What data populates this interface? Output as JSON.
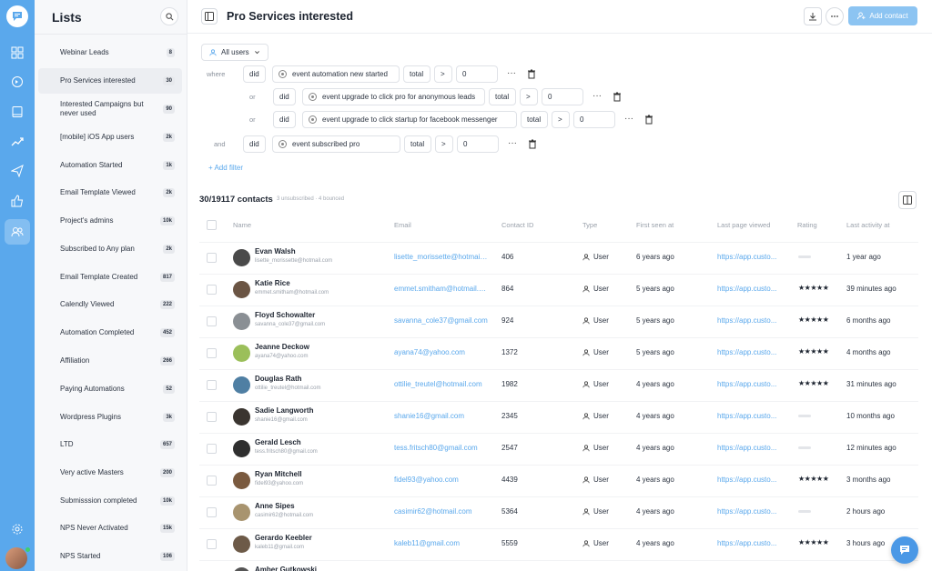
{
  "lists": {
    "title": "Lists",
    "items": [
      {
        "label": "Webinar Leads",
        "count": "8"
      },
      {
        "label": "Pro Services interested",
        "count": "30"
      },
      {
        "label": "Interested Campaigns but never used",
        "count": "90"
      },
      {
        "label": "[mobile] iOS App users",
        "count": "2k"
      },
      {
        "label": "Automation Started",
        "count": "1k"
      },
      {
        "label": "Email Template Viewed",
        "count": "2k"
      },
      {
        "label": "Project's admins",
        "count": "10k"
      },
      {
        "label": "Subscribed to Any plan",
        "count": "2k"
      },
      {
        "label": "Email Template Created",
        "count": "817"
      },
      {
        "label": "Calendly Viewed",
        "count": "222"
      },
      {
        "label": "Automation Completed",
        "count": "452"
      },
      {
        "label": "Affiliation",
        "count": "266"
      },
      {
        "label": "Paying Automations",
        "count": "52"
      },
      {
        "label": "Wordpress Plugins",
        "count": "3k"
      },
      {
        "label": "LTD",
        "count": "657"
      },
      {
        "label": "Very active Masters",
        "count": "200"
      },
      {
        "label": "Submisssion completed",
        "count": "10k"
      },
      {
        "label": "NPS Never Activated",
        "count": "15k"
      },
      {
        "label": "NPS Started",
        "count": "106"
      }
    ]
  },
  "header": {
    "title": "Pro Services interested",
    "add_contact": "Add contact"
  },
  "filters": {
    "audience": "All users",
    "add_filter": "+ Add filter",
    "rows": [
      {
        "connector": "where",
        "op": "did",
        "event": "event automation new started",
        "agg": "total",
        "cmp": ">",
        "value": "0"
      },
      {
        "connector": "or",
        "op": "did",
        "event": "event upgrade to click pro for anonymous leads",
        "agg": "total",
        "cmp": ">",
        "value": "0"
      },
      {
        "connector": "or",
        "op": "did",
        "event": "event upgrade to click startup for facebook messenger",
        "agg": "total",
        "cmp": ">",
        "value": "0"
      },
      {
        "connector": "and",
        "op": "did",
        "event": "event subscribed pro",
        "agg": "total",
        "cmp": ">",
        "value": "0"
      }
    ],
    "more": "···"
  },
  "contacts": {
    "heading": "30/19117 contacts",
    "sub": "3 unsubscribed · 4 bounced",
    "columns": [
      "Name",
      "Email",
      "Contact ID",
      "Type",
      "First seen at",
      "Last page viewed",
      "Rating",
      "Last activity at"
    ],
    "rows": [
      {
        "name": "Evan Walsh",
        "sub": "lisette_morissette@hotmail.com",
        "email": "lisette_morissette@hotmail.com",
        "id": "406",
        "type": "User",
        "first": "6 years ago",
        "page": "https://app.custo...",
        "rating": "",
        "last": "1 year ago",
        "avatar": "#4a4a4a"
      },
      {
        "name": "Katie Rice",
        "sub": "emmet.smitham@hotmail.com",
        "email": "emmet.smitham@hotmail.com",
        "id": "864",
        "type": "User",
        "first": "5 years ago",
        "page": "https://app.custo...",
        "rating": "★★★★★",
        "last": "39 minutes ago",
        "avatar": "#6b5544"
      },
      {
        "name": "Floyd Schowalter",
        "sub": "savanna_cole37@gmail.com",
        "email": "savanna_cole37@gmail.com",
        "id": "924",
        "type": "User",
        "first": "5 years ago",
        "page": "https://app.custo...",
        "rating": "★★★★★",
        "last": "6 months ago",
        "avatar": "#8a8f94"
      },
      {
        "name": "Jeanne Deckow",
        "sub": "ayana74@yahoo.com",
        "email": "ayana74@yahoo.com",
        "id": "1372",
        "type": "User",
        "first": "5 years ago",
        "page": "https://app.custo...",
        "rating": "★★★★★",
        "last": "4 months ago",
        "avatar": "#9bbf5a"
      },
      {
        "name": "Douglas Rath",
        "sub": "ottilie_treutel@hotmail.com",
        "email": "ottilie_treutel@hotmail.com",
        "id": "1982",
        "type": "User",
        "first": "4 years ago",
        "page": "https://app.custo...",
        "rating": "★★★★★",
        "last": "31 minutes ago",
        "avatar": "#4f7fa3"
      },
      {
        "name": "Sadie Langworth",
        "sub": "shanie16@gmail.com",
        "email": "shanie16@gmail.com",
        "id": "2345",
        "type": "User",
        "first": "4 years ago",
        "page": "https://app.custo...",
        "rating": "",
        "last": "10 months ago",
        "avatar": "#3a3530"
      },
      {
        "name": "Gerald Lesch",
        "sub": "tess.fritsch80@gmail.com",
        "email": "tess.fritsch80@gmail.com",
        "id": "2547",
        "type": "User",
        "first": "4 years ago",
        "page": "https://app.custo...",
        "rating": "",
        "last": "12 minutes ago",
        "avatar": "#2f2f2f"
      },
      {
        "name": "Ryan Mitchell",
        "sub": "fidel93@yahoo.com",
        "email": "fidel93@yahoo.com",
        "id": "4439",
        "type": "User",
        "first": "4 years ago",
        "page": "https://app.custo...",
        "rating": "★★★★★",
        "last": "3 months ago",
        "avatar": "#7a5a3f"
      },
      {
        "name": "Anne Sipes",
        "sub": "casimir62@hotmail.com",
        "email": "casimir62@hotmail.com",
        "id": "5364",
        "type": "User",
        "first": "4 years ago",
        "page": "https://app.custo...",
        "rating": "",
        "last": "2 hours ago",
        "avatar": "#a8946f"
      },
      {
        "name": "Gerardo Keebler",
        "sub": "kaleb11@gmail.com",
        "email": "kaleb11@gmail.com",
        "id": "5559",
        "type": "User",
        "first": "4 years ago",
        "page": "https://app.custo...",
        "rating": "★★★★★",
        "last": "3 hours ago",
        "avatar": "#6d5a48"
      },
      {
        "name": "Amber Gutkowski",
        "sub": "",
        "email": "",
        "id": "",
        "type": "",
        "first": "",
        "page": "",
        "rating": "",
        "last": "",
        "avatar": "#555"
      }
    ]
  },
  "colors": {
    "accent": "#5aa8ec",
    "rail": "#5aa8ec"
  },
  "icons": [
    "logo-icon",
    "dashboard-icon",
    "automation-icon",
    "book-icon",
    "trend-icon",
    "send-icon",
    "thumbs-up-icon",
    "users-icon",
    "settings-icon",
    "search-icon",
    "download-icon",
    "more-icon",
    "columns-icon",
    "chat-icon"
  ]
}
